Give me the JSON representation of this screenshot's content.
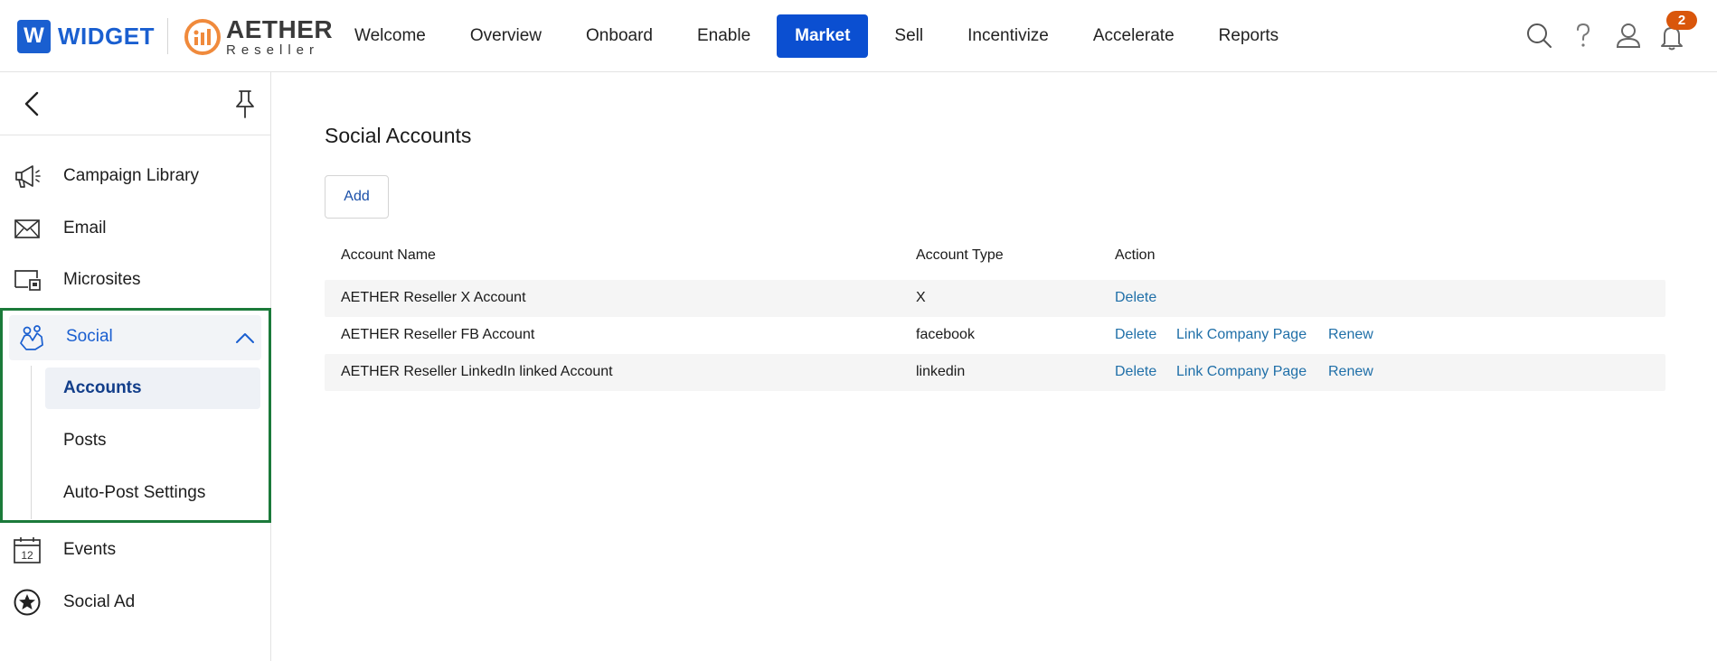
{
  "brand": {
    "widget_letter": "W",
    "widget_name": "WIDGET",
    "aether_name": "AETHER",
    "aether_sub": "Reseller",
    "widget_color": "#1a5fd0",
    "aether_color": "#f08a3c"
  },
  "nav": {
    "items": [
      {
        "label": "Welcome"
      },
      {
        "label": "Overview"
      },
      {
        "label": "Onboard"
      },
      {
        "label": "Enable"
      },
      {
        "label": "Market",
        "active": true
      },
      {
        "label": "Sell"
      },
      {
        "label": "Incentivize"
      },
      {
        "label": "Accelerate"
      },
      {
        "label": "Reports"
      }
    ],
    "active_color": "#0b4fd1"
  },
  "header_icons": {
    "search": "search-icon",
    "help": "help-icon",
    "user": "user-icon",
    "notifications": "bell-icon",
    "notification_count": "2"
  },
  "sidebar": {
    "items": [
      {
        "label": "Campaign Library",
        "icon": "megaphone-icon"
      },
      {
        "label": "Email",
        "icon": "envelope-icon"
      },
      {
        "label": "Microsites",
        "icon": "microsite-icon"
      },
      {
        "label": "Social",
        "icon": "social-icon",
        "expanded": true
      },
      {
        "label": "Events",
        "icon": "calendar-icon"
      },
      {
        "label": "Social Ad",
        "icon": "star-badge-icon"
      }
    ],
    "social_sub": [
      {
        "label": "Accounts",
        "active": true
      },
      {
        "label": "Posts"
      },
      {
        "label": "Auto-Post Settings"
      }
    ],
    "calendar_day": "12",
    "highlight_color": "#1b7a3a"
  },
  "main": {
    "title": "Social Accounts",
    "add_label": "Add",
    "columns": [
      "Account Name",
      "Account Type",
      "Action"
    ],
    "rows": [
      {
        "name": "AETHER Reseller X Account",
        "type": "X",
        "actions": [
          "Delete"
        ]
      },
      {
        "name": "AETHER Reseller FB Account",
        "type": "facebook",
        "actions": [
          "Delete",
          "Link Company Page",
          "Renew"
        ]
      },
      {
        "name": "AETHER Reseller LinkedIn linked Account",
        "type": "linkedin",
        "actions": [
          "Delete",
          "Link Company Page",
          "Renew"
        ]
      }
    ]
  }
}
